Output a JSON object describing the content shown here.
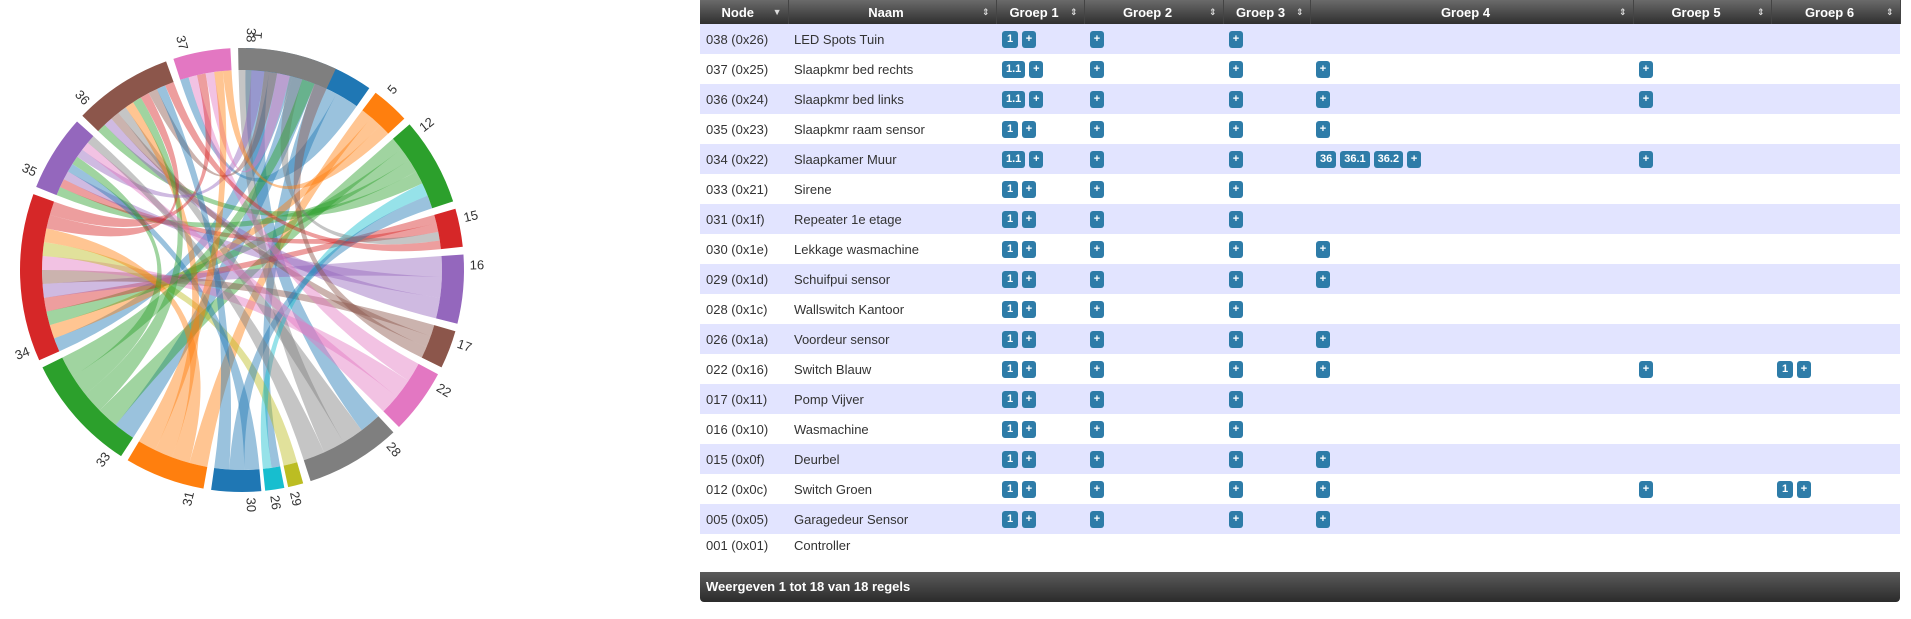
{
  "chord": {
    "groups": [
      {
        "label": "1",
        "color": "#1f77b4"
      },
      {
        "label": "5",
        "color": "#ff7f0e"
      },
      {
        "label": "12",
        "color": "#2ca02c"
      },
      {
        "label": "15",
        "color": "#d62728"
      },
      {
        "label": "16",
        "color": "#9467bd"
      },
      {
        "label": "17",
        "color": "#8c564b"
      },
      {
        "label": "22",
        "color": "#e377c2"
      },
      {
        "label": "28",
        "color": "#7f7f7f"
      },
      {
        "label": "29",
        "color": "#bcbd22"
      },
      {
        "label": "26",
        "color": "#17becf"
      },
      {
        "label": "30",
        "color": "#1f77b4"
      },
      {
        "label": "31",
        "color": "#ff7f0e"
      },
      {
        "label": "33",
        "color": "#2ca02c"
      },
      {
        "label": "34",
        "color": "#d62728"
      },
      {
        "label": "35",
        "color": "#9467bd"
      },
      {
        "label": "36",
        "color": "#8c564b"
      },
      {
        "label": "37",
        "color": "#e377c2"
      },
      {
        "label": "38",
        "color": "#7f7f7f"
      }
    ]
  },
  "table": {
    "headers": {
      "node": "Node",
      "naam": "Naam",
      "g1": "Groep 1",
      "g2": "Groep 2",
      "g3": "Groep 3",
      "g4": "Groep 4",
      "g5": "Groep 5",
      "g6": "Groep 6"
    },
    "add_label": "+",
    "rows": [
      {
        "node": "038 (0x26)",
        "naam": "LED Spots Tuin",
        "g1": [
          "1"
        ],
        "g2": [],
        "g3": [],
        "g4": null,
        "g5": null,
        "g6": null
      },
      {
        "node": "037 (0x25)",
        "naam": "Slaapkmr bed rechts",
        "g1": [
          "1.1"
        ],
        "g2": [],
        "g3": [],
        "g4": [],
        "g5": [],
        "g6": null
      },
      {
        "node": "036 (0x24)",
        "naam": "Slaapkmr bed links",
        "g1": [
          "1.1"
        ],
        "g2": [],
        "g3": [],
        "g4": [],
        "g5": [],
        "g6": null
      },
      {
        "node": "035 (0x23)",
        "naam": "Slaapkmr raam sensor",
        "g1": [
          "1"
        ],
        "g2": [],
        "g3": [],
        "g4": [],
        "g5": null,
        "g6": null
      },
      {
        "node": "034 (0x22)",
        "naam": "Slaapkamer Muur",
        "g1": [
          "1.1"
        ],
        "g2": [],
        "g3": [],
        "g4": [
          "36",
          "36.1",
          "36.2"
        ],
        "g5": [],
        "g6": null
      },
      {
        "node": "033 (0x21)",
        "naam": "Sirene",
        "g1": [
          "1"
        ],
        "g2": [],
        "g3": [],
        "g4": null,
        "g5": null,
        "g6": null
      },
      {
        "node": "031 (0x1f)",
        "naam": "Repeater 1e etage",
        "g1": [
          "1"
        ],
        "g2": [],
        "g3": [],
        "g4": null,
        "g5": null,
        "g6": null
      },
      {
        "node": "030 (0x1e)",
        "naam": "Lekkage wasmachine",
        "g1": [
          "1"
        ],
        "g2": [],
        "g3": [],
        "g4": [],
        "g5": null,
        "g6": null
      },
      {
        "node": "029 (0x1d)",
        "naam": "Schuifpui sensor",
        "g1": [
          "1"
        ],
        "g2": [],
        "g3": [],
        "g4": [],
        "g5": null,
        "g6": null
      },
      {
        "node": "028 (0x1c)",
        "naam": "Wallswitch Kantoor",
        "g1": [
          "1"
        ],
        "g2": [],
        "g3": [],
        "g4": null,
        "g5": null,
        "g6": null
      },
      {
        "node": "026 (0x1a)",
        "naam": "Voordeur sensor",
        "g1": [
          "1"
        ],
        "g2": [],
        "g3": [],
        "g4": [],
        "g5": null,
        "g6": null
      },
      {
        "node": "022 (0x16)",
        "naam": "Switch Blauw",
        "g1": [
          "1"
        ],
        "g2": [],
        "g3": [],
        "g4": [],
        "g5": [],
        "g6": [
          "1"
        ]
      },
      {
        "node": "017 (0x11)",
        "naam": "Pomp Vijver",
        "g1": [
          "1"
        ],
        "g2": [],
        "g3": [],
        "g4": null,
        "g5": null,
        "g6": null
      },
      {
        "node": "016 (0x10)",
        "naam": "Wasmachine",
        "g1": [
          "1"
        ],
        "g2": [],
        "g3": [],
        "g4": null,
        "g5": null,
        "g6": null
      },
      {
        "node": "015 (0x0f)",
        "naam": "Deurbel",
        "g1": [
          "1"
        ],
        "g2": [],
        "g3": [],
        "g4": [],
        "g5": null,
        "g6": null
      },
      {
        "node": "012 (0x0c)",
        "naam": "Switch Groen",
        "g1": [
          "1"
        ],
        "g2": [],
        "g3": [],
        "g4": [],
        "g5": [],
        "g6": [
          "1"
        ]
      },
      {
        "node": "005 (0x05)",
        "naam": "Garagedeur Sensor",
        "g1": [
          "1"
        ],
        "g2": [],
        "g3": [],
        "g4": [],
        "g5": null,
        "g6": null
      },
      {
        "node": "001 (0x01)",
        "naam": "Controller",
        "g1": null,
        "g2": null,
        "g3": null,
        "g4": null,
        "g5": null,
        "g6": null
      }
    ],
    "footer": "Weergeven 1 tot 18 van 18 regels"
  }
}
